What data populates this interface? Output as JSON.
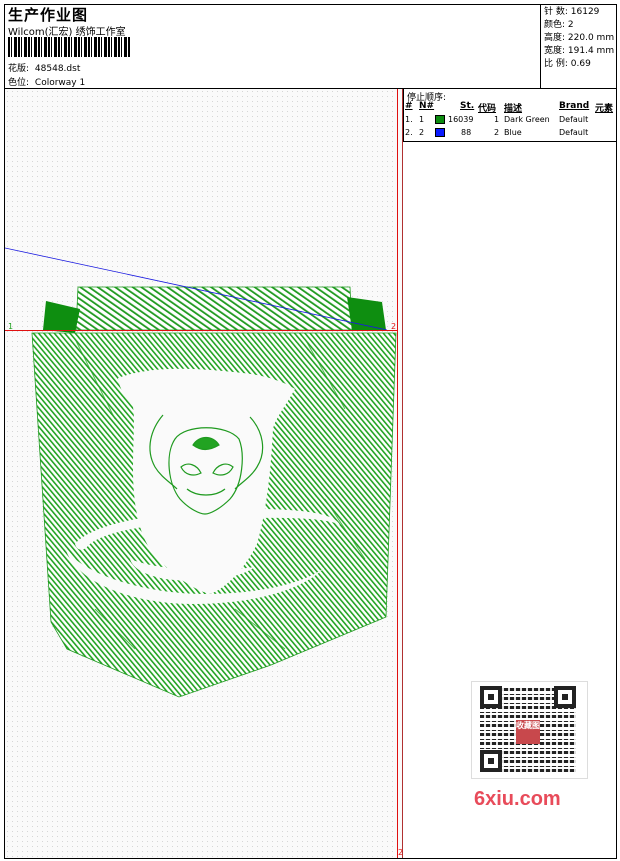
{
  "header": {
    "title": "生产作业图",
    "subtitle": "Wilcom(汇宏) 绣饰工作室",
    "design_label": "花版:",
    "design_file": "48548.dst",
    "colorway_label": "色位:",
    "colorway": "Colorway 1"
  },
  "info": {
    "stitches_label": "针 数:",
    "stitches": "16129",
    "colors_label": "颜色:",
    "colors": "2",
    "height_label": "高度:",
    "height": "220.0 mm",
    "width_label": "宽度:",
    "width": "191.4 mm",
    "ratio_label": "比 例:",
    "ratio": "0.69"
  },
  "stop_sequence": {
    "title": "停止顺序:",
    "columns": [
      "#",
      "N#",
      "St.",
      "代码",
      "描述",
      "Brand",
      "元素"
    ],
    "rows": [
      {
        "index": "1.",
        "needle": "1",
        "color": "#0c8c10",
        "stitches": "16039",
        "code": "1",
        "description": "Dark Green",
        "brand": "Default"
      },
      {
        "index": "2.",
        "needle": "2",
        "color": "#0a1aff",
        "stitches": "88",
        "code": "2",
        "description": "Blue",
        "brand": "Default"
      }
    ]
  },
  "markers": {
    "start": "1",
    "end": "2",
    "bottom": "2"
  },
  "watermark": {
    "text": "6xiu.com",
    "stamp": "收藏图"
  },
  "colors": {
    "embroidery": "#20a020",
    "guide_red": "#e01010",
    "jump_blue": "#1a1ae0"
  }
}
